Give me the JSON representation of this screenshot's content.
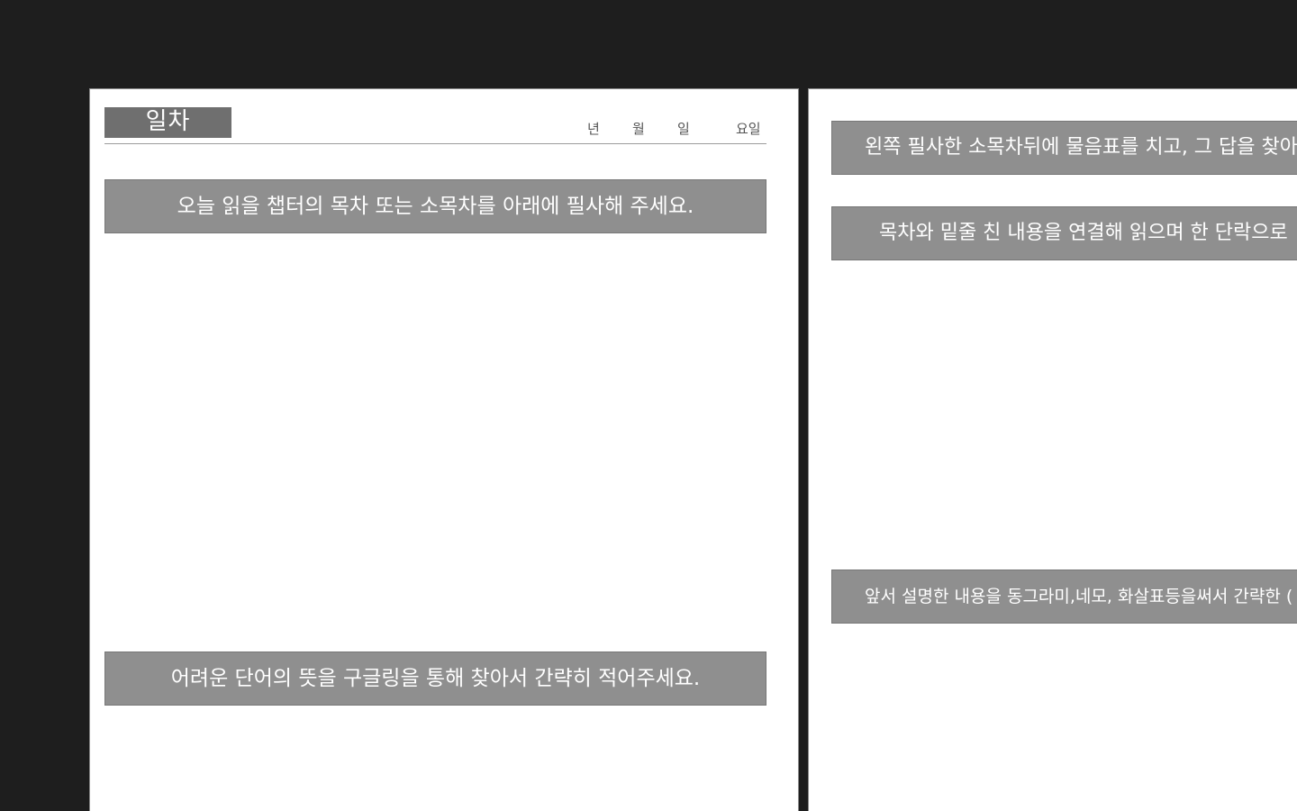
{
  "left_page": {
    "day_label": "일차",
    "date": {
      "year": "년",
      "month": "월",
      "day": "일",
      "weekday": "요일"
    },
    "instruction_toc": "오늘 읽을 챕터의 목차 또는 소목차를 아래에 필사해 주세요.",
    "instruction_vocab": "어려운 단어의 뜻을 구글링을 통해 찾아서 간략히 적어주세요."
  },
  "right_page": {
    "instruction_question": "왼쪽 필사한 소목차뒤에 물음표를 치고, 그 답을 찾아 읽",
    "instruction_connect": "목차와 밑줄 친 내용을 연결해 읽으며 한 단락으로",
    "instruction_diagram": "앞서 설명한 내용을 동그라미,네모, 화살표등을써서 간략한 ("
  }
}
